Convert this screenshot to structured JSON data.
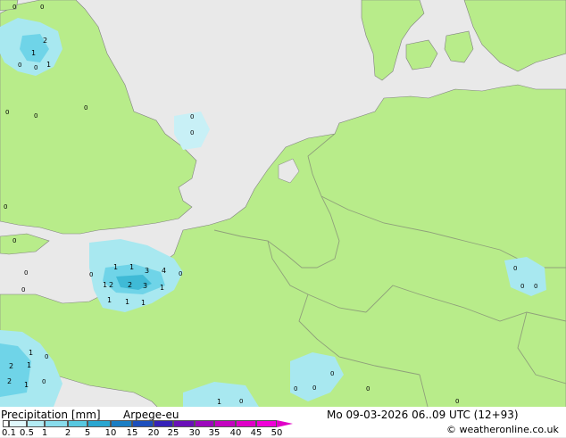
{
  "map": {
    "land_color": "#b8ec8a",
    "sea_color": "#e9e9e9",
    "border_color": "#8fa07a",
    "coast_color": "#808080",
    "precip_colors": {
      "light": "#a8e8f0",
      "medium": "#6fd4e8",
      "heavy": "#3fbad6"
    },
    "rain_labels": [
      "1",
      "1",
      "1",
      "3",
      "4",
      "2",
      "2",
      "3",
      "1",
      "1",
      "1",
      "1",
      "2",
      "1",
      "1",
      "1",
      "2",
      "2",
      "1",
      "1",
      "1"
    ],
    "zero_markers": "0"
  },
  "footer": {
    "title": "Precipitation [mm]",
    "model": "Arpege-eu",
    "datetime": "Mo 09-03-2026 06..09 UTC (12+93)",
    "copyright": "weatheronline.co.uk",
    "copyright_symbol": "©"
  },
  "colorbar": {
    "labels": [
      "0.1",
      "0.5",
      "1",
      "2",
      "5",
      "10",
      "15",
      "20",
      "25",
      "30",
      "35",
      "40",
      "45",
      "50"
    ],
    "colors": [
      "#ffffff",
      "#e0f8fc",
      "#b4ecf4",
      "#88dcec",
      "#58c8e0",
      "#2aa6d0",
      "#1a7ec4",
      "#1c4fbc",
      "#3622b8",
      "#6a10b8",
      "#9c08bc",
      "#c404c0",
      "#e000c8",
      "#f000d8"
    ]
  }
}
